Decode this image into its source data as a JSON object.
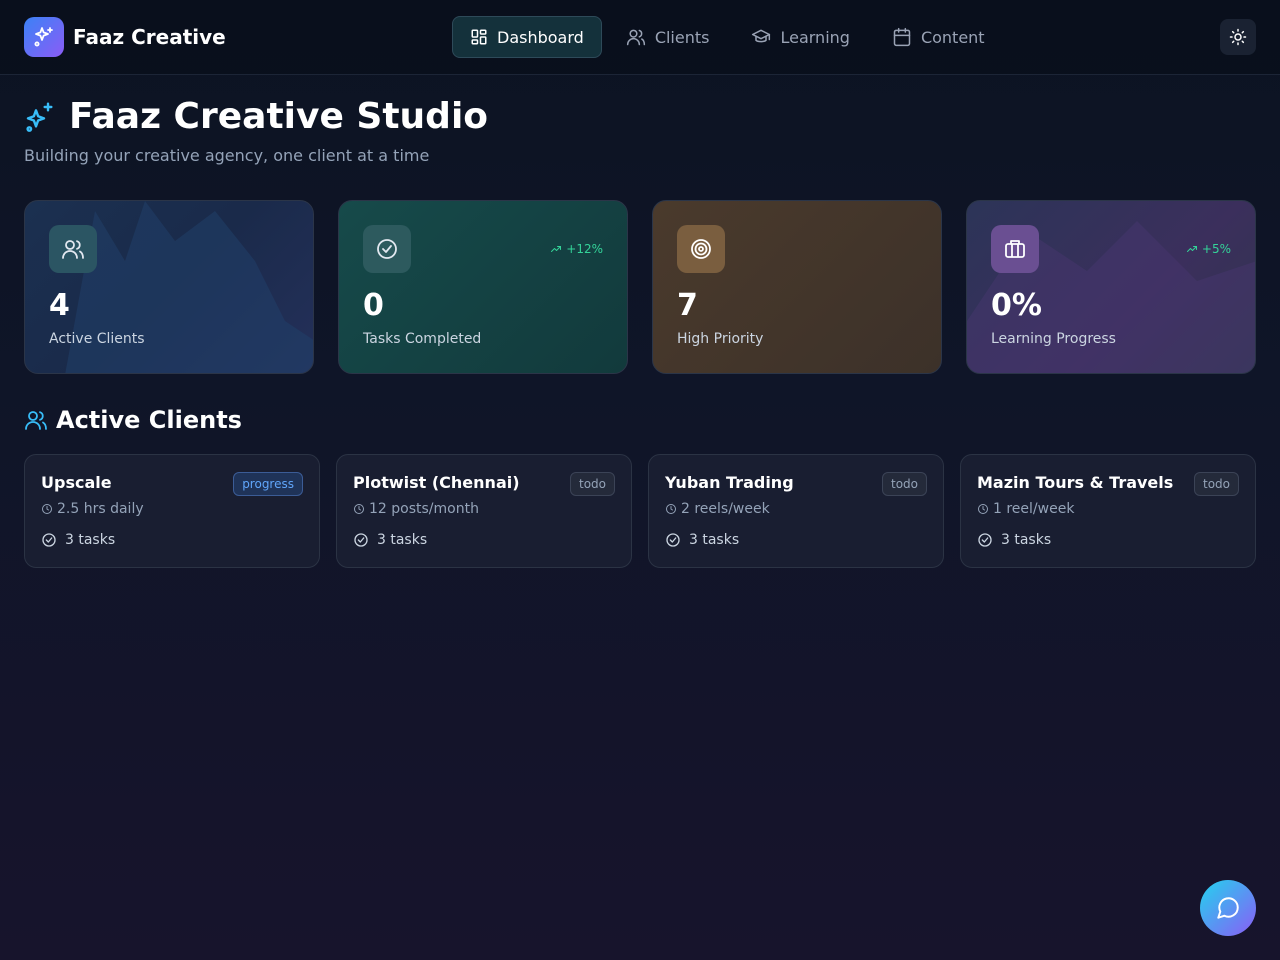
{
  "app": {
    "brand_name": "Faaz Creative",
    "accent": "#3b82f6",
    "brand_gradient": [
      "#3b82f6",
      "#8b5cf6"
    ]
  },
  "nav": {
    "items": [
      {
        "label": "Dashboard",
        "icon": "layout-grid-icon",
        "active": true
      },
      {
        "label": "Clients",
        "icon": "users-icon",
        "active": false
      },
      {
        "label": "Learning",
        "icon": "graduation-cap-icon",
        "active": false
      },
      {
        "label": "Content",
        "icon": "calendar-icon",
        "active": false
      }
    ],
    "theme_toggle_icon": "sun-icon"
  },
  "header": {
    "title": "Faaz Creative Studio",
    "title_icon": "sparkles-icon",
    "subtitle": "Building your creative agency, one client at a time"
  },
  "stats": [
    {
      "value": "4",
      "label": "Active Clients",
      "icon": "users-icon",
      "trend": null,
      "color": "#1e3a5f"
    },
    {
      "value": "0",
      "label": "Tasks Completed",
      "icon": "check-circle-icon",
      "trend": "+12%",
      "color": "#134e4a"
    },
    {
      "value": "7",
      "label": "High Priority",
      "icon": "target-icon",
      "trend": null,
      "color": "#4a3a2c"
    },
    {
      "value": "0%",
      "label": "Learning Progress",
      "icon": "briefcase-icon",
      "trend": "+5%",
      "color": "#3b2f5c"
    }
  ],
  "clients_section": {
    "title": "Active Clients",
    "icon": "users-icon",
    "clients": [
      {
        "name": "Upscale",
        "status": "progress",
        "frequency": "2.5 hrs daily",
        "tasks": "3 tasks"
      },
      {
        "name": "Plotwist (Chennai)",
        "status": "todo",
        "frequency": "12 posts/month",
        "tasks": "3 tasks"
      },
      {
        "name": "Yuban Trading",
        "status": "todo",
        "frequency": "2 reels/week",
        "tasks": "3 tasks"
      },
      {
        "name": "Mazin Tours & Travels",
        "status": "todo",
        "frequency": "1 reel/week",
        "tasks": "3 tasks"
      }
    ]
  },
  "chat_button": {
    "icon": "message-circle-icon"
  }
}
